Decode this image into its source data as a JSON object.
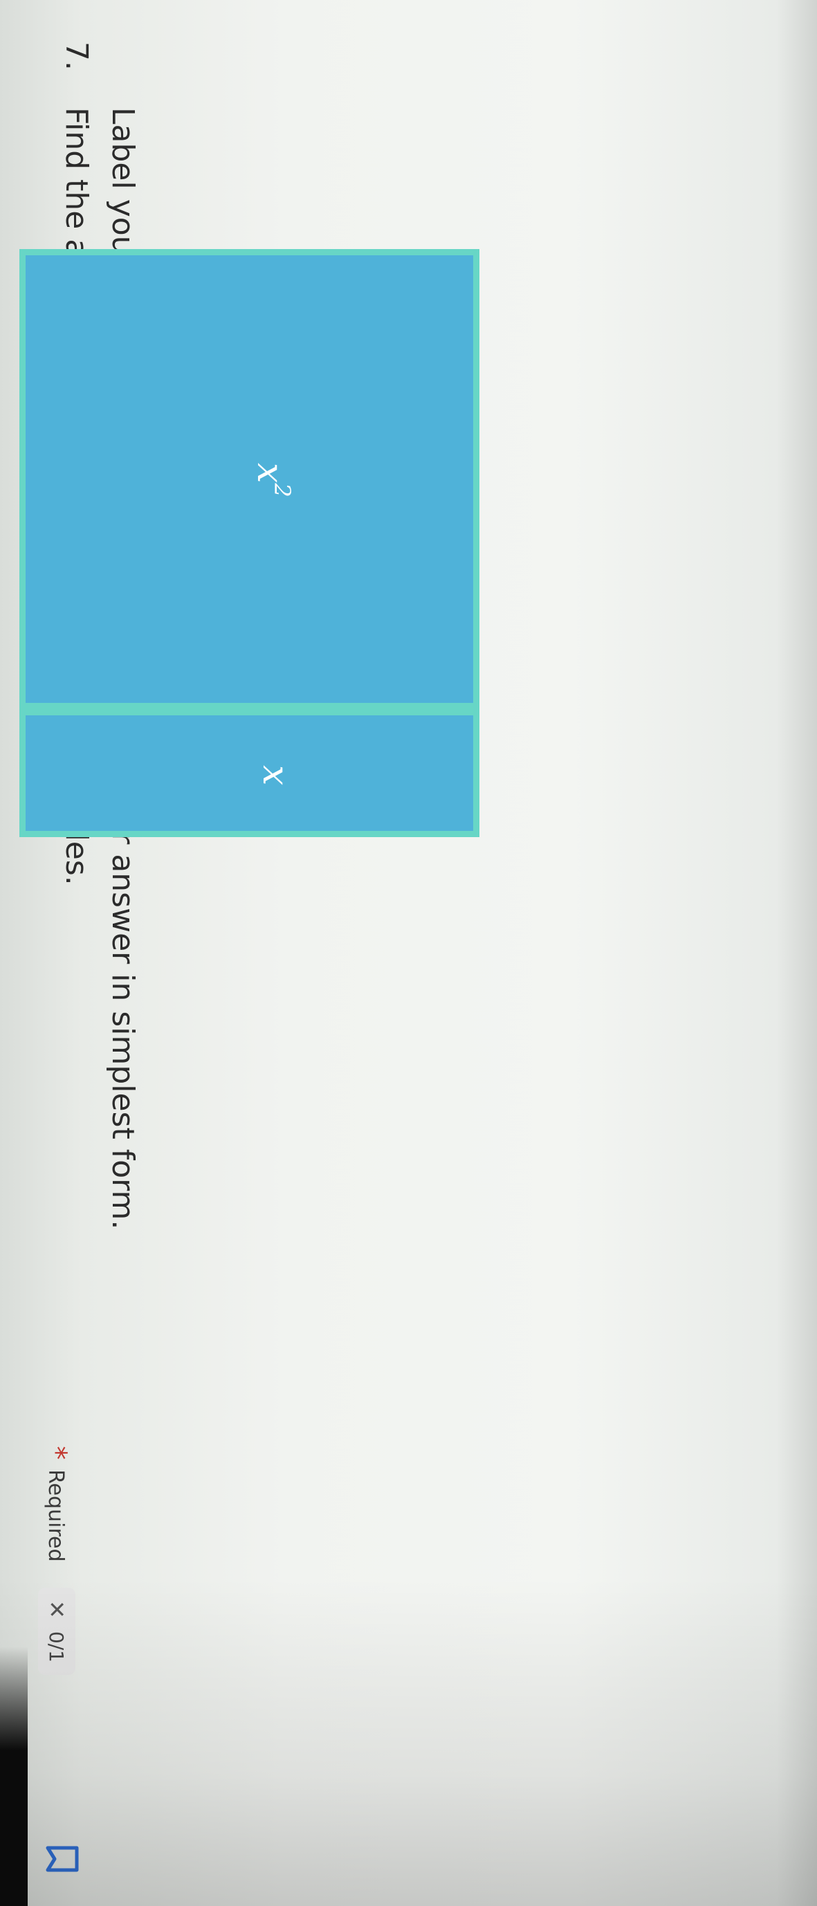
{
  "question": {
    "number": "7.",
    "title": "Find the area of the shape made with algebra tiles.",
    "instruction": "Label your answer \"square units\" and write your answer in simplest form."
  },
  "status": {
    "required_mark": "*",
    "required_label": "Required",
    "score_icon": "close-x-icon",
    "score": "0/1",
    "bookmark_icon": "bookmark-icon"
  },
  "tiles": {
    "x_squared": {
      "base": "x",
      "exponent": "2"
    },
    "x": {
      "label": "x"
    }
  },
  "colors": {
    "tile_fill": "#4fb2d9",
    "tile_border": "#67d6c6",
    "required_star": "#c2382f"
  }
}
